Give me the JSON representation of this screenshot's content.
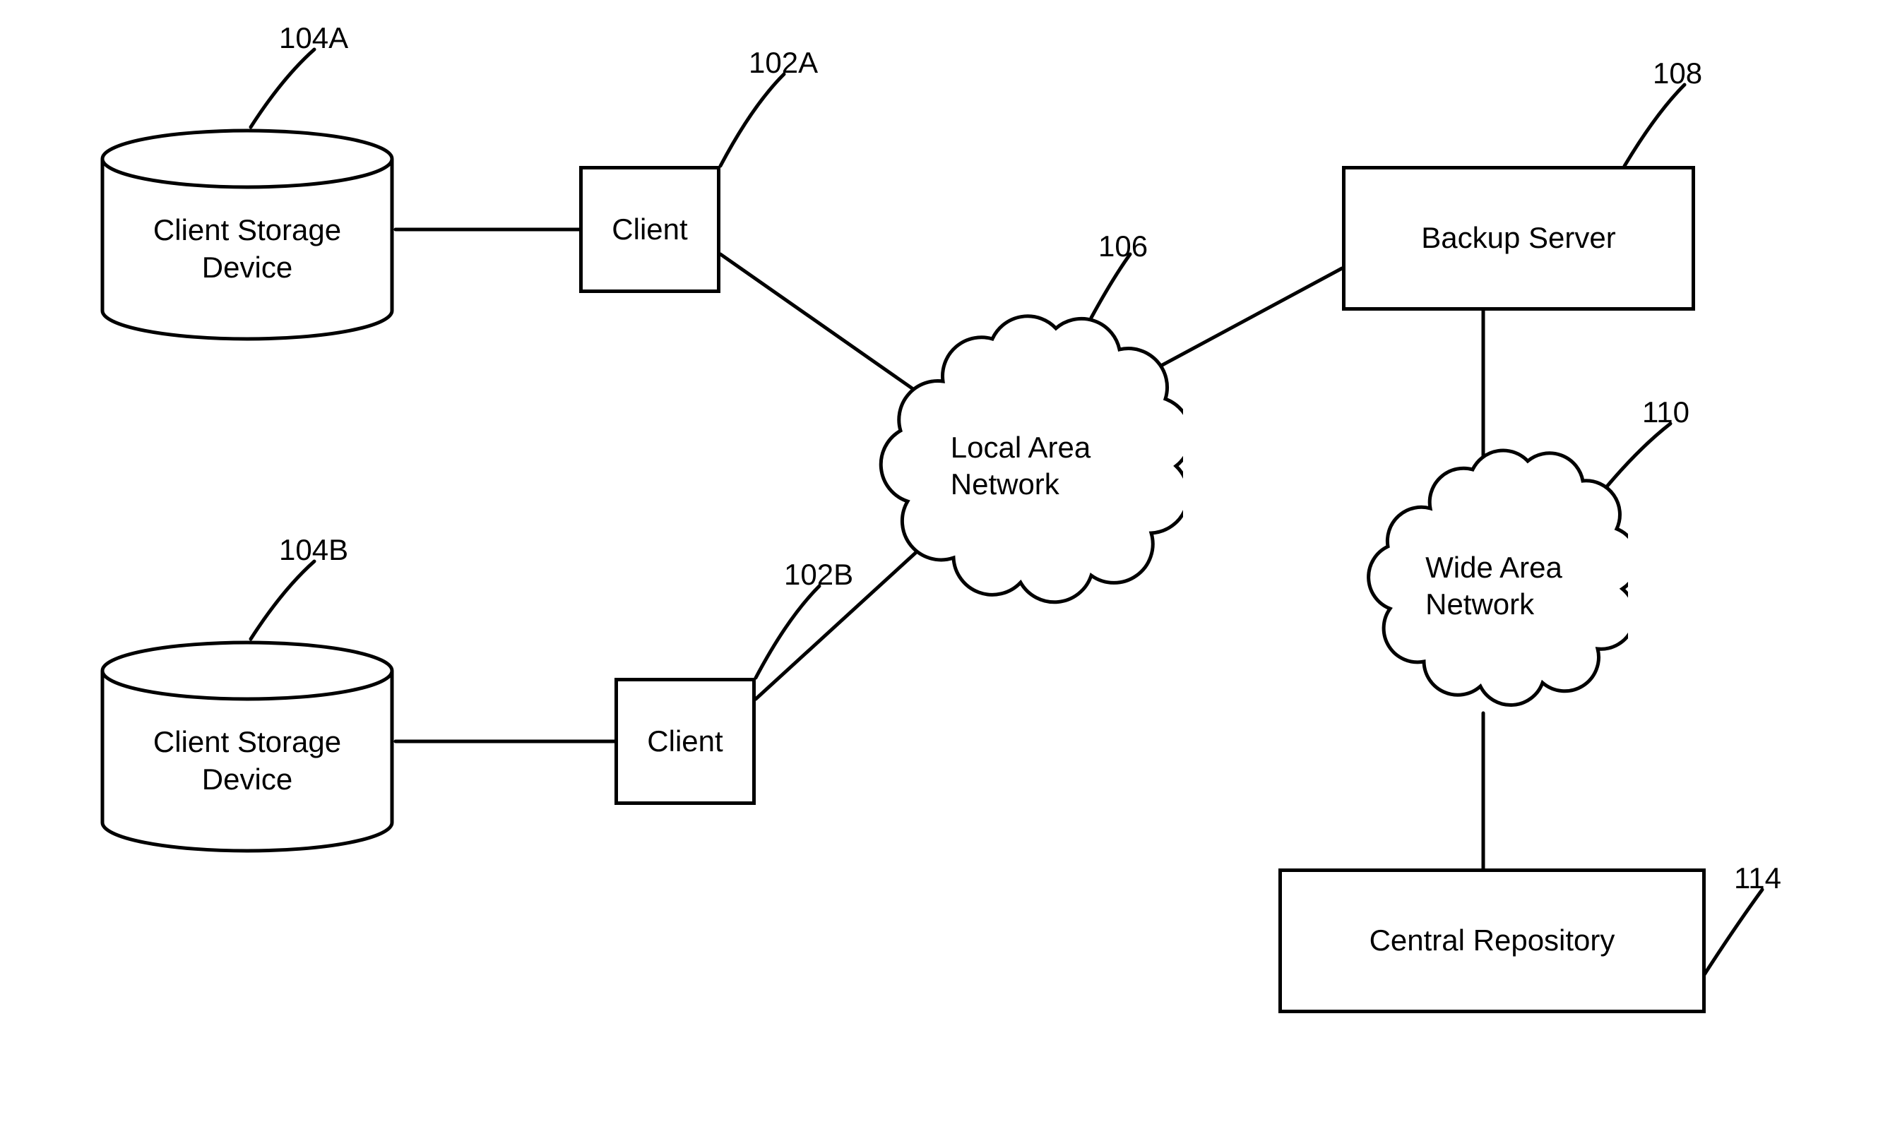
{
  "nodes": {
    "storage_a": {
      "label": "Client Storage\nDevice",
      "ref": "104A"
    },
    "storage_b": {
      "label": "Client Storage\nDevice",
      "ref": "104B"
    },
    "client_a": {
      "label": "Client",
      "ref": "102A"
    },
    "client_b": {
      "label": "Client",
      "ref": "102B"
    },
    "lan": {
      "label": "Local Area\nNetwork",
      "ref": "106"
    },
    "backup": {
      "label": "Backup Server",
      "ref": "108"
    },
    "wan": {
      "label": "Wide Area\nNetwork",
      "ref": "110"
    },
    "central": {
      "label": "Central Repository",
      "ref": "114"
    }
  }
}
